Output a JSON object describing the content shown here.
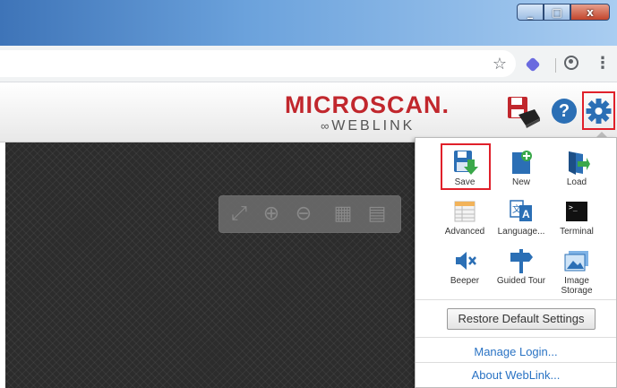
{
  "window": {
    "minimize_glyph": "_",
    "maximize_glyph": "□",
    "close_glyph": "x"
  },
  "browser": {
    "star_glyph": "☆",
    "menu_glyph": "⋮"
  },
  "app": {
    "logo_main": "MICROSCAN.",
    "logo_sub": "WEBLINK",
    "help_glyph": "?"
  },
  "viewer": {
    "tools": [
      "fit-icon",
      "zoom-in-icon",
      "zoom-out-icon",
      "grid-icon",
      "save-image-icon"
    ],
    "tool_glyphs": [
      "⤢",
      "⊕",
      "⊖",
      "▦",
      "▤"
    ]
  },
  "menu": {
    "items": [
      {
        "label": "Save"
      },
      {
        "label": "New"
      },
      {
        "label": "Load"
      },
      {
        "label": "Advanced"
      },
      {
        "label": "Language..."
      },
      {
        "label": "Terminal"
      },
      {
        "label": "Beeper"
      },
      {
        "label": "Guided Tour"
      },
      {
        "label": "Image Storage"
      }
    ],
    "restore_label": "Restore Default Settings",
    "manage_login": "Manage Login...",
    "about": "About WebLink..."
  },
  "colors": {
    "brand": "#c1272d",
    "link": "#2a73c4",
    "highlight": "#e0202a"
  }
}
